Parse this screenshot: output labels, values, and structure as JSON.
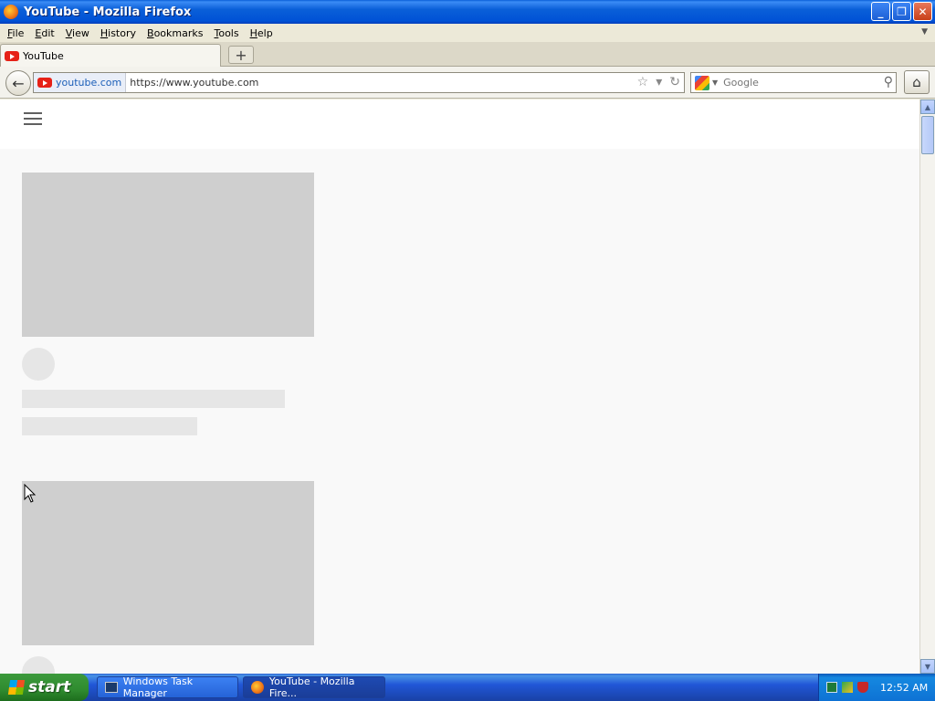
{
  "window": {
    "title": "YouTube - Mozilla Firefox",
    "buttons": {
      "minimize": "_",
      "restore": "❐",
      "close": "✕"
    }
  },
  "menubar": {
    "items": [
      "File",
      "Edit",
      "View",
      "History",
      "Bookmarks",
      "Tools",
      "Help"
    ]
  },
  "tabs": [
    {
      "label": "YouTube",
      "icon": "youtube-icon"
    }
  ],
  "newtab": {
    "label": "+"
  },
  "navbar": {
    "site_label": "youtube.com",
    "url": "https://www.youtube.com",
    "search_placeholder": "Google"
  },
  "taskbar": {
    "start_label": "start",
    "tasks": [
      {
        "label": "Windows Task Manager",
        "icon": "task-manager-icon"
      },
      {
        "label": "YouTube - Mozilla Fire...",
        "icon": "firefox-icon"
      }
    ],
    "clock": "12:52 AM"
  },
  "colors": {
    "youtube_red": "#e62117",
    "xp_blue": "#0a5fd8",
    "start_green": "#2f8b2f",
    "skeleton": "#cfcfcf"
  }
}
